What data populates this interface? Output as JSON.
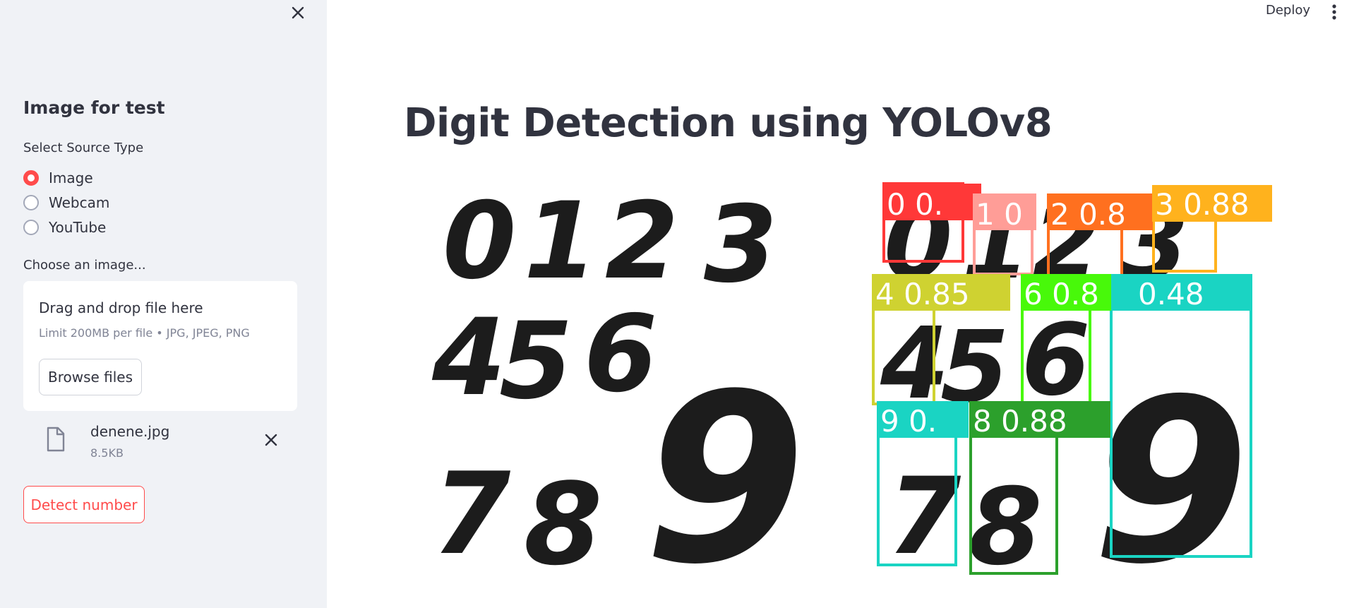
{
  "sidebar": {
    "title": "Image for test",
    "source_label": "Select Source Type",
    "sources": [
      {
        "label": "Image",
        "selected": true
      },
      {
        "label": "Webcam",
        "selected": false
      },
      {
        "label": "YouTube",
        "selected": false
      }
    ],
    "choose_label": "Choose an image...",
    "dropzone": {
      "title": "Drag and drop file here",
      "limit": "Limit 200MB per file • JPG, JPEG, PNG",
      "browse_label": "Browse files"
    },
    "file": {
      "name": "denene.jpg",
      "size": "8.5KB"
    },
    "detect_label": "Detect number"
  },
  "header": {
    "deploy_label": "Deploy"
  },
  "main": {
    "title": "Digit Detection using YOLOv8",
    "uploaded_digits": [
      "0",
      "1",
      "2",
      "3",
      "4",
      "5",
      "6",
      "7",
      "8",
      "9"
    ],
    "detections": [
      {
        "label": "0 0.",
        "color": "#ff3838"
      },
      {
        "label": "1 0",
        "color": "#ff9d97"
      },
      {
        "label": "2 0.8",
        "color": "#ff701f"
      },
      {
        "label": "3 0.88",
        "color": "#ffb21d"
      },
      {
        "label": "4 0.85",
        "color": "#cfd231"
      },
      {
        "label": "6 0.8",
        "color": "#48f90a"
      },
      {
        "label": "0.48",
        "color": "#1ad4c3"
      },
      {
        "label": "9 0.",
        "color": "#1ad4c3"
      },
      {
        "label": "8 0.88",
        "color": "#2ca02c"
      }
    ]
  }
}
